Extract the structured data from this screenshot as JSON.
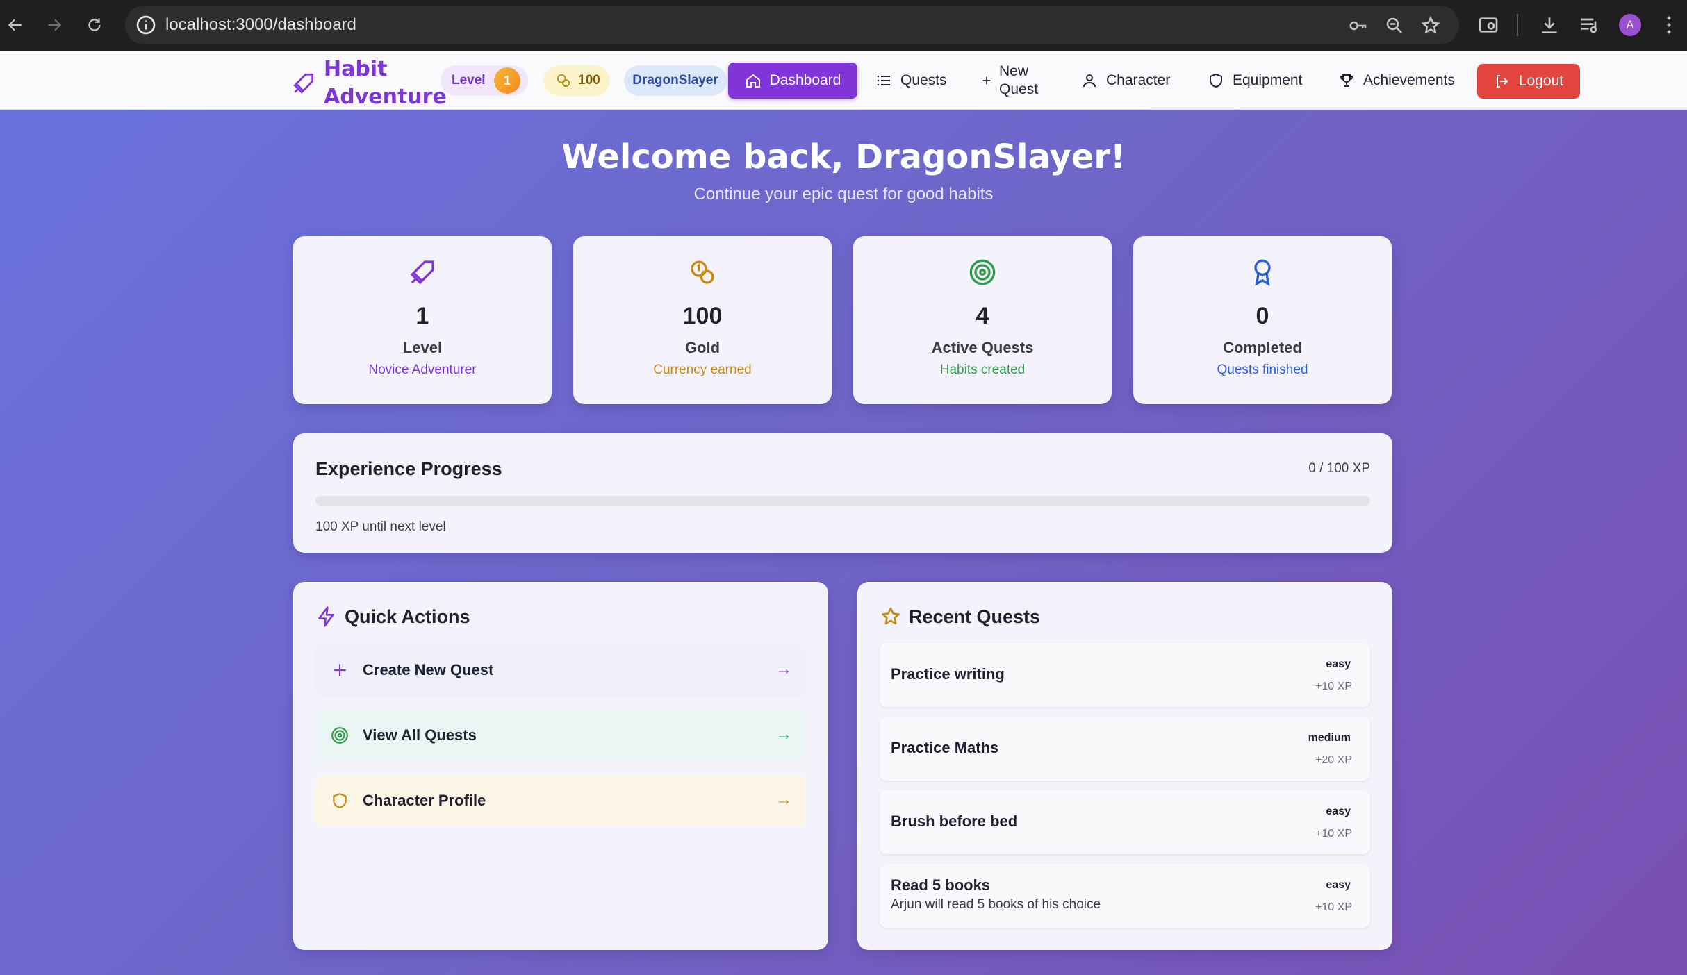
{
  "browser": {
    "url": "localhost:3000/dashboard",
    "avatar_letter": "A"
  },
  "header": {
    "brand_line1": "Habit",
    "brand_line2": "Adventure",
    "level_label": "Level",
    "level_value": "1",
    "gold_value": "100",
    "username": "DragonSlayer",
    "nav": {
      "dashboard": "Dashboard",
      "quests": "Quests",
      "new_quest": "New Quest",
      "character": "Character",
      "equipment": "Equipment",
      "achievements": "Achievements"
    },
    "logout": "Logout"
  },
  "welcome": {
    "title": "Welcome back, DragonSlayer!",
    "subtitle": "Continue your epic quest for good habits"
  },
  "stats": [
    {
      "icon": "sword-icon",
      "value": "1",
      "label": "Level",
      "sub": "Novice Adventurer",
      "color": "#8135d8"
    },
    {
      "icon": "coins-icon",
      "value": "100",
      "label": "Gold",
      "sub": "Currency earned",
      "color": "#c88a10"
    },
    {
      "icon": "target-icon",
      "value": "4",
      "label": "Active Quests",
      "sub": "Habits created",
      "color": "#2f9a4a"
    },
    {
      "icon": "award-icon",
      "value": "0",
      "label": "Completed",
      "sub": "Quests finished",
      "color": "#2a5fd6"
    }
  ],
  "experience": {
    "title": "Experience Progress",
    "ratio": "0 / 100 XP",
    "progress": 0,
    "note": "100 XP until next level"
  },
  "quick_actions": {
    "title": "Quick Actions",
    "items": [
      {
        "label": "Create New Quest",
        "icon": "plus-icon",
        "arrow": "→"
      },
      {
        "label": "View All Quests",
        "icon": "target-icon",
        "arrow": "→"
      },
      {
        "label": "Character Profile",
        "icon": "shield-icon",
        "arrow": "→"
      }
    ]
  },
  "recent_quests": {
    "title": "Recent Quests",
    "items": [
      {
        "name": "Practice writing",
        "desc": "",
        "difficulty": "easy",
        "xp": "+10 XP"
      },
      {
        "name": "Practice Maths",
        "desc": "",
        "difficulty": "medium",
        "xp": "+20 XP"
      },
      {
        "name": "Brush before bed",
        "desc": "",
        "difficulty": "easy",
        "xp": "+10 XP"
      },
      {
        "name": "Read 5 books",
        "desc": "Arjun will read 5 books of his choice",
        "difficulty": "easy",
        "xp": "+10 XP"
      }
    ]
  }
}
